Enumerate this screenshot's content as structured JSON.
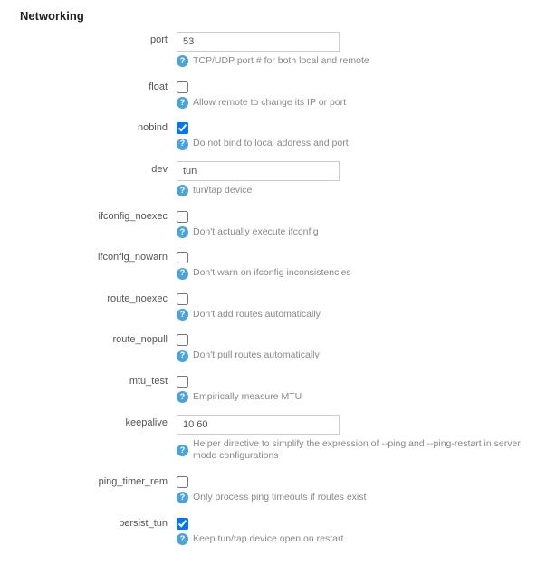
{
  "section_title": "Networking",
  "help_glyph": "?",
  "fields": {
    "port": {
      "label": "port",
      "type": "text",
      "value": "53",
      "help": "TCP/UDP port # for both local and remote"
    },
    "float": {
      "label": "float",
      "type": "checkbox",
      "checked": false,
      "help": "Allow remote to change its IP or port"
    },
    "nobind": {
      "label": "nobind",
      "type": "checkbox",
      "checked": true,
      "help": "Do not bind to local address and port"
    },
    "dev": {
      "label": "dev",
      "type": "text",
      "value": "tun",
      "help": "tun/tap device"
    },
    "ifconfig_noexec": {
      "label": "ifconfig_noexec",
      "type": "checkbox",
      "checked": false,
      "help": "Don't actually execute ifconfig"
    },
    "ifconfig_nowarn": {
      "label": "ifconfig_nowarn",
      "type": "checkbox",
      "checked": false,
      "help": "Don't warn on ifconfig inconsistencies"
    },
    "route_noexec": {
      "label": "route_noexec",
      "type": "checkbox",
      "checked": false,
      "help": "Don't add routes automatically"
    },
    "route_nopull": {
      "label": "route_nopull",
      "type": "checkbox",
      "checked": false,
      "help": "Don't pull routes automatically"
    },
    "mtu_test": {
      "label": "mtu_test",
      "type": "checkbox",
      "checked": false,
      "help": "Empirically measure MTU"
    },
    "keepalive": {
      "label": "keepalive",
      "type": "text",
      "value": "10 60",
      "help": "Helper directive to simplify the expression of --ping and --ping-restart in server mode configurations"
    },
    "ping_timer_rem": {
      "label": "ping_timer_rem",
      "type": "checkbox",
      "checked": false,
      "help": "Only process ping timeouts if routes exist"
    },
    "persist_tun": {
      "label": "persist_tun",
      "type": "checkbox",
      "checked": true,
      "help": "Keep tun/tap device open on restart"
    }
  }
}
